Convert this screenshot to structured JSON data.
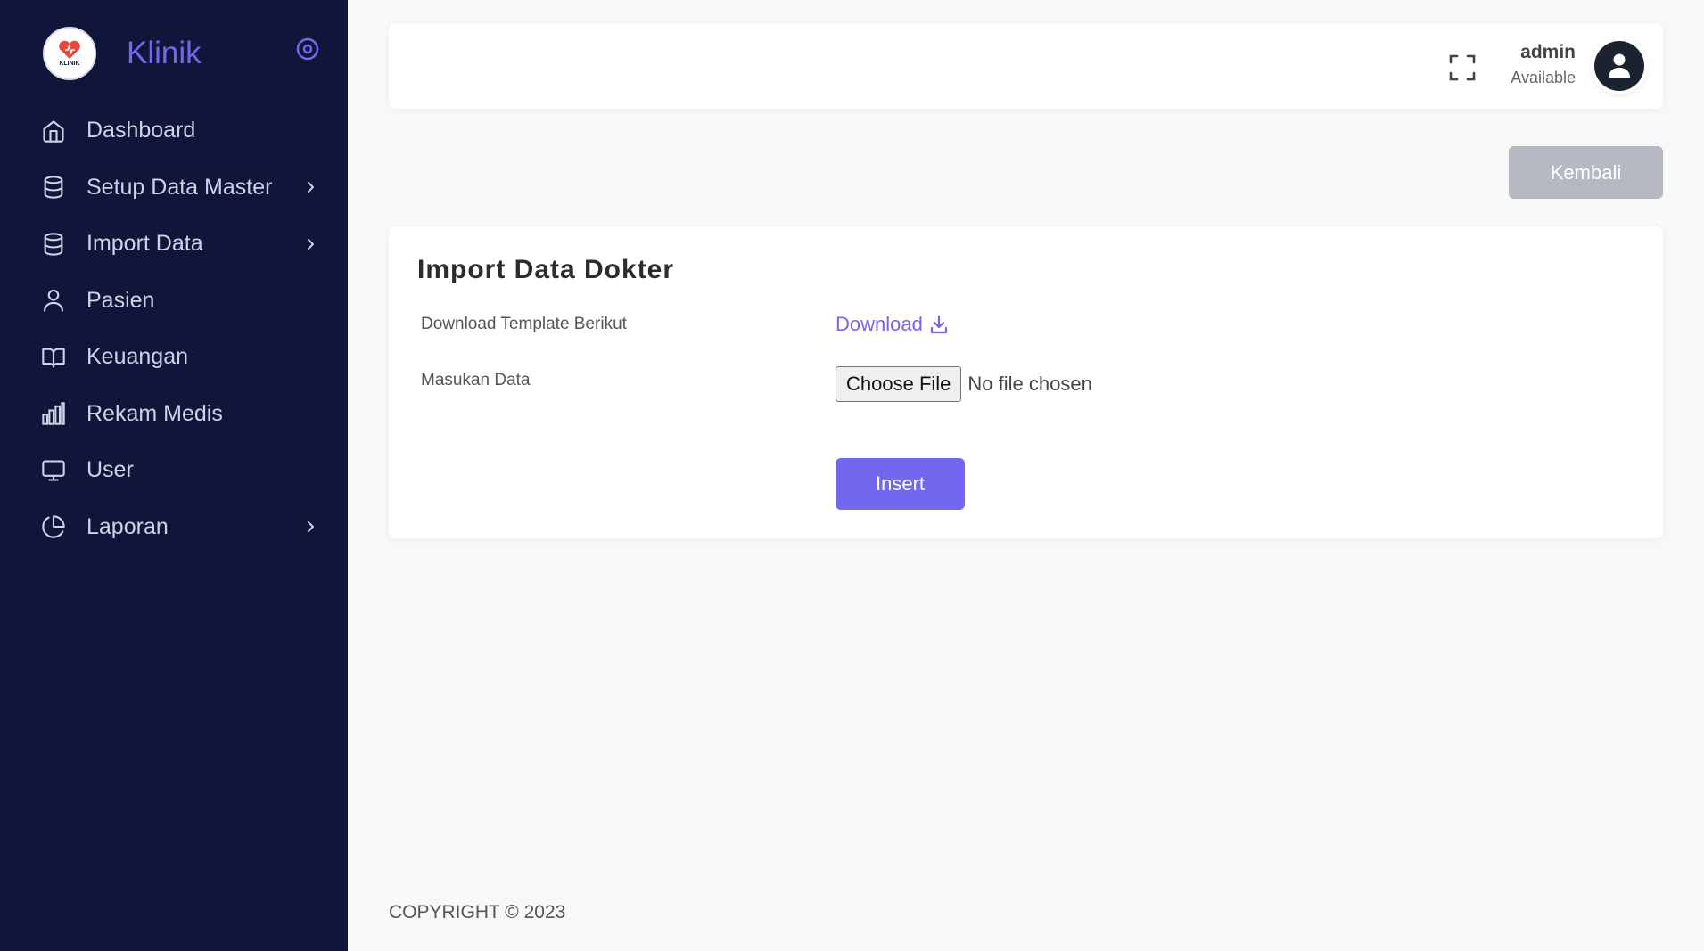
{
  "brand": {
    "name": "Klinik",
    "logo_text": "KLINIK",
    "accent": "#7367f0",
    "sidebar_bg": "#10163a"
  },
  "sidebar": {
    "items": [
      {
        "label": "Dashboard",
        "icon": "home-icon",
        "has_submenu": false
      },
      {
        "label": "Setup Data Master",
        "icon": "database-icon",
        "has_submenu": true
      },
      {
        "label": "Import Data",
        "icon": "database-icon",
        "has_submenu": true
      },
      {
        "label": "Pasien",
        "icon": "user-icon",
        "has_submenu": false
      },
      {
        "label": "Keuangan",
        "icon": "book-open-icon",
        "has_submenu": false
      },
      {
        "label": "Rekam Medis",
        "icon": "bar-chart-icon",
        "has_submenu": false
      },
      {
        "label": "User",
        "icon": "monitor-icon",
        "has_submenu": false
      },
      {
        "label": "Laporan",
        "icon": "pie-chart-icon",
        "has_submenu": true
      }
    ]
  },
  "header": {
    "user_name": "admin",
    "user_status": "Available"
  },
  "actions": {
    "back_label": "Kembali"
  },
  "card": {
    "title": "Import Data Dokter",
    "download_row_label": "Download Template Berikut",
    "download_link_label": "Download",
    "input_row_label": "Masukan Data",
    "choose_file_label": "Choose File",
    "no_file_text": "No file chosen",
    "insert_label": "Insert"
  },
  "footer": {
    "copyright": "COPYRIGHT © 2023"
  }
}
